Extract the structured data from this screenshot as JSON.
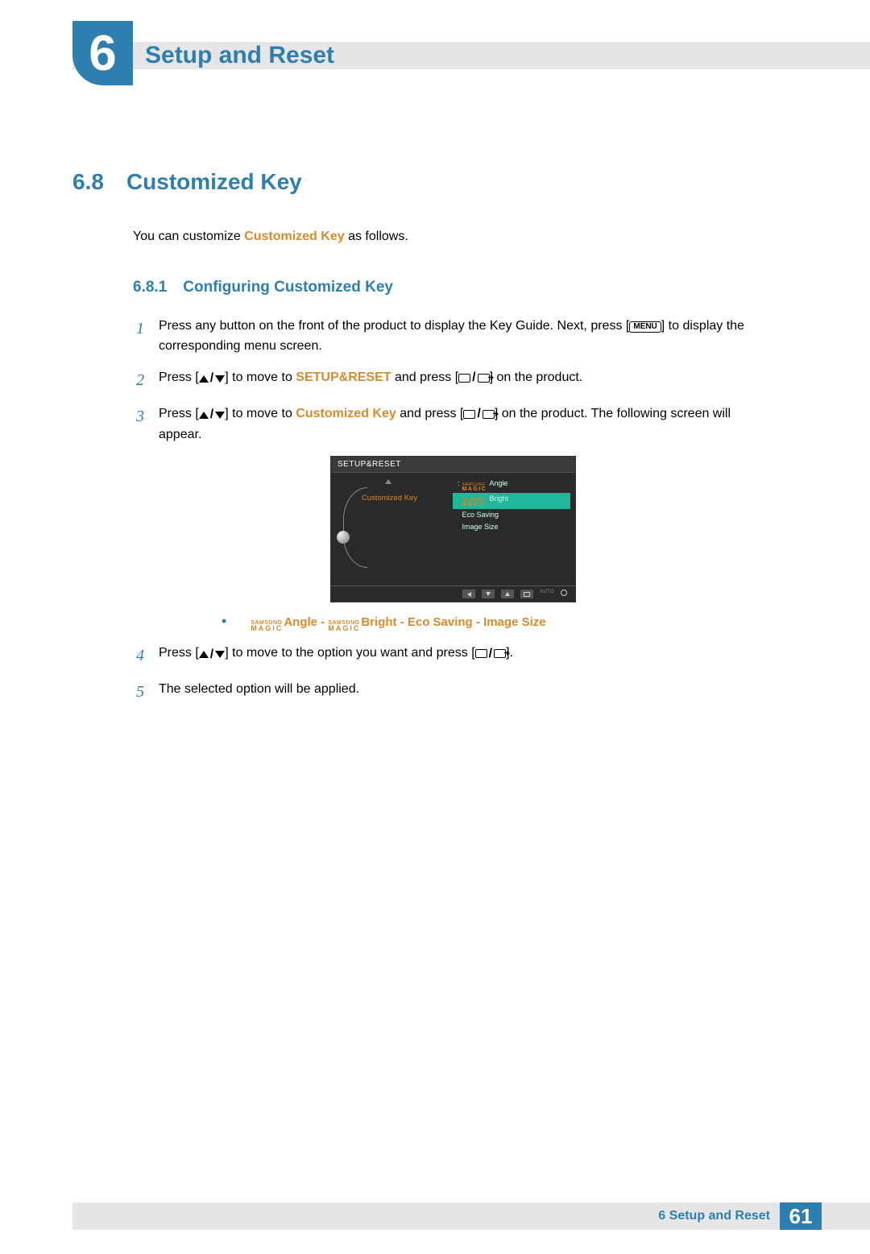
{
  "header": {
    "chapter_number": "6",
    "chapter_title": "Setup and Reset"
  },
  "section": {
    "number": "6.8",
    "title": "Customized Key",
    "intro_pre": "You can customize ",
    "intro_bold": "Customized Key",
    "intro_post": " as follows."
  },
  "subsection": {
    "number": "6.8.1",
    "title": "Configuring Customized Key"
  },
  "steps": {
    "s1": {
      "num": "1",
      "pre": "Press any button on the front of the product to display the Key Guide. Next, press [",
      "menu": "MENU",
      "post": "] to display the corresponding menu screen."
    },
    "s2": {
      "num": "2",
      "pre": "Press [",
      "mid1": "] to move to ",
      "target": "SETUP&RESET",
      "mid2": " and press [",
      "post": "] on the product."
    },
    "s3": {
      "num": "3",
      "pre": "Press [",
      "mid1": "] to move to ",
      "target": "Customized Key",
      "mid2": " and press [",
      "post": "] on the product. The following screen will appear."
    },
    "s4": {
      "num": "4",
      "pre": "Press [",
      "mid1": "] to move to the option you want and press [",
      "post": "]."
    },
    "s5": {
      "num": "5",
      "text": "The selected option will be applied."
    }
  },
  "osd": {
    "title": "SETUP&RESET",
    "selected_label": "Customized Key",
    "colon": ":",
    "samsung": "SAMSUNG",
    "magic": "MAGIC",
    "opt_angle": "Angle",
    "opt_bright": "Bright",
    "opt_eco": "Eco Saving",
    "opt_size": "Image Size",
    "nav_auto": "AUTO"
  },
  "bullet": {
    "samsung": "SAMSUNG",
    "magic": "MAGIC",
    "angle": "Angle",
    "sep": " - ",
    "bright": "Bright",
    "eco": "Eco Saving",
    "size": "Image Size"
  },
  "footer": {
    "text": "6 Setup and Reset",
    "page": "61"
  }
}
